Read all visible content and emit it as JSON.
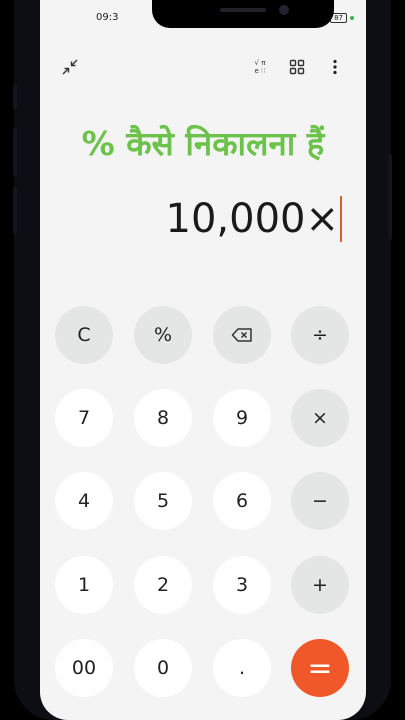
{
  "status": {
    "time": "09:3",
    "battery": "87"
  },
  "toolbar": {
    "collapse_icon": "collapse-arrows-icon",
    "scientific_icon": "scientific-mode-icon",
    "scientific_top": "√ π",
    "scientific_bottom": "e ∷",
    "apps_icon": "grid-icon",
    "menu_icon": "more-vertical-icon"
  },
  "headline": "% कैसे निकालना हैं",
  "display": {
    "expression": "10,000×"
  },
  "keys": {
    "clear": "C",
    "percent": "%",
    "divide": "÷",
    "seven": "7",
    "eight": "8",
    "nine": "9",
    "multiply": "×",
    "four": "4",
    "five": "5",
    "six": "6",
    "minus": "−",
    "one": "1",
    "two": "2",
    "three": "3",
    "plus": "+",
    "double_zero": "00",
    "zero": "0",
    "dot": ".",
    "equals": "="
  },
  "colors": {
    "accent": "#f0582a",
    "headline": "#6cc24a",
    "function_key": "#e4e6e6",
    "number_key": "#ffffff",
    "screen_bg": "#f4f4f4"
  }
}
